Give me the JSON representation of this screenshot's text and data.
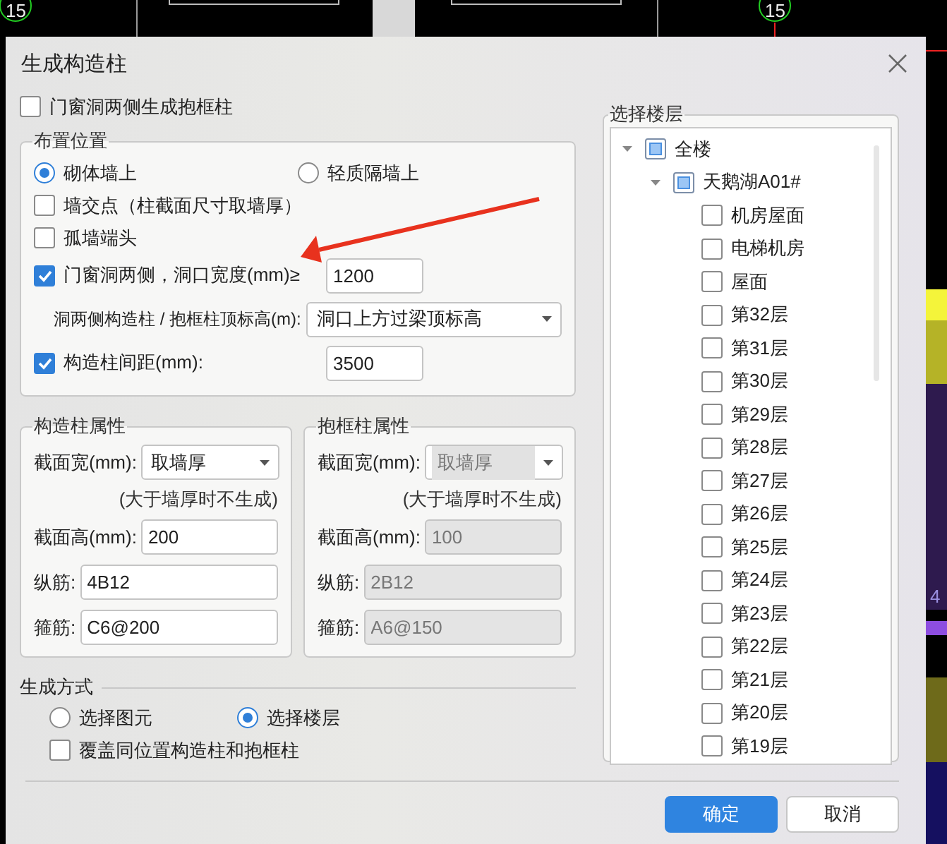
{
  "cad_view": {
    "labels": [
      {
        "text": "15"
      },
      {
        "text": "15"
      },
      {
        "text": "4"
      }
    ]
  },
  "dialog": {
    "title": "生成构造柱",
    "frame_option": {
      "label": "门窗洞两侧生成抱框柱",
      "checked": false
    },
    "placement": {
      "title": "布置位置",
      "options": [
        {
          "label": "砌体墙上",
          "selected": true
        },
        {
          "label": "轻质隔墙上",
          "selected": false
        }
      ],
      "rows": [
        {
          "kind": "check",
          "label": "墙交点（柱截面尺寸取墙厚）",
          "checked": false
        },
        {
          "kind": "check",
          "label": "孤墙端头",
          "checked": false
        },
        {
          "kind": "check",
          "label": "门窗洞两侧，洞口宽度(mm)≥",
          "checked": true,
          "value": "1200"
        },
        {
          "kind": "select",
          "label": "洞两侧构造柱 / 抱框柱顶标高(m):",
          "value": "洞口上方过梁顶标高"
        },
        {
          "kind": "check",
          "label": "构造柱间距(mm):",
          "checked": true,
          "value": "3500"
        }
      ]
    },
    "column_groups": [
      {
        "title": "构造柱属性",
        "disabled": false,
        "fields": [
          {
            "kind": "select",
            "label": "截面宽(mm):",
            "value": "取墙厚"
          },
          {
            "kind": "note",
            "text": "(大于墙厚时不生成)"
          },
          {
            "kind": "input",
            "label": "截面高(mm):",
            "value": "200"
          },
          {
            "kind": "input",
            "label": "纵筋:",
            "value": "4B12"
          },
          {
            "kind": "input",
            "label": "箍筋:",
            "value": "C6@200"
          }
        ]
      },
      {
        "title": "抱框柱属性",
        "disabled": true,
        "fields": [
          {
            "kind": "select",
            "label": "截面宽(mm):",
            "value": "取墙厚"
          },
          {
            "kind": "note",
            "text": "(大于墙厚时不生成)"
          },
          {
            "kind": "input",
            "label": "截面高(mm):",
            "value": "100"
          },
          {
            "kind": "input",
            "label": "纵筋:",
            "value": "2B12"
          },
          {
            "kind": "input",
            "label": "箍筋:",
            "value": "A6@150"
          }
        ]
      }
    ],
    "generation": {
      "title": "生成方式",
      "options": [
        {
          "label": "选择图元",
          "selected": false
        },
        {
          "label": "选择楼层",
          "selected": true
        }
      ],
      "overwrite": {
        "label": "覆盖同位置构造柱和抱框柱",
        "checked": false
      }
    },
    "floors": {
      "title": "选择楼层",
      "tree": [
        {
          "label": "全楼",
          "partial": true,
          "expanded": true,
          "children": [
            {
              "label": "天鹅湖A01#",
              "partial": true,
              "expanded": true,
              "children": [
                {
                  "label": "机房屋面",
                  "checked": false
                },
                {
                  "label": "电梯机房",
                  "checked": false
                },
                {
                  "label": "屋面",
                  "checked": false
                },
                {
                  "label": "第32层",
                  "checked": false
                },
                {
                  "label": "第31层",
                  "checked": false
                },
                {
                  "label": "第30层",
                  "checked": false
                },
                {
                  "label": "第29层",
                  "checked": false
                },
                {
                  "label": "第28层",
                  "checked": false
                },
                {
                  "label": "第27层",
                  "checked": false
                },
                {
                  "label": "第26层",
                  "checked": false
                },
                {
                  "label": "第25层",
                  "checked": false
                },
                {
                  "label": "第24层",
                  "checked": false
                },
                {
                  "label": "第23层",
                  "checked": false
                },
                {
                  "label": "第22层",
                  "checked": false
                },
                {
                  "label": "第21层",
                  "checked": false
                },
                {
                  "label": "第20层",
                  "checked": false
                },
                {
                  "label": "第19层",
                  "checked": false
                }
              ]
            }
          ]
        }
      ]
    },
    "buttons": [
      {
        "label": "确定",
        "primary": true
      },
      {
        "label": "取消",
        "primary": false
      }
    ]
  }
}
